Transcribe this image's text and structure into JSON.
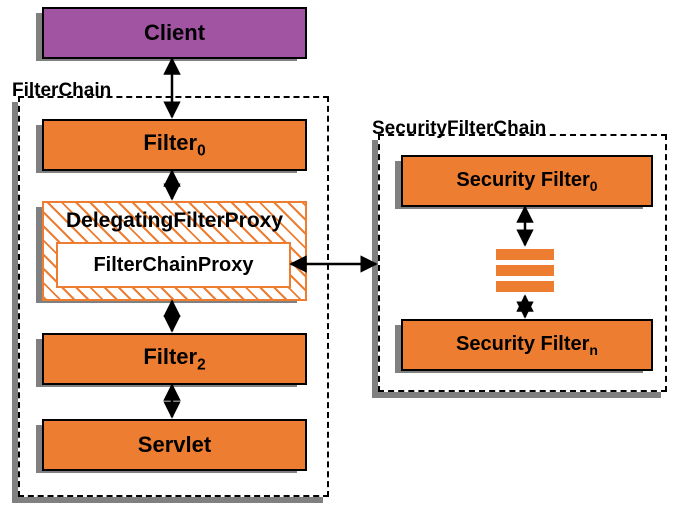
{
  "client": {
    "label": "Client"
  },
  "filterchain": {
    "title": "FilterChain",
    "filter0": "Filter",
    "filter0_sub": "0",
    "delegating": "DelegatingFilterProxy",
    "fcp": "FilterChainProxy",
    "filter2": "Filter",
    "filter2_sub": "2",
    "servlet": "Servlet"
  },
  "securitychain": {
    "title": "SecurityFilterChain",
    "sf0": "Security Filter",
    "sf0_sub": "0",
    "sfn": "Security Filter",
    "sfn_sub": "n"
  }
}
